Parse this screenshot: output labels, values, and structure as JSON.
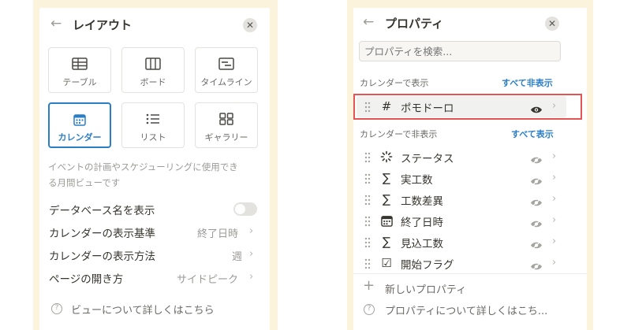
{
  "layout_panel": {
    "title": "レイアウト",
    "layouts": [
      {
        "label": "テーブル",
        "icon": "table-icon",
        "selected": false
      },
      {
        "label": "ボード",
        "icon": "board-icon",
        "selected": false
      },
      {
        "label": "タイムライン",
        "icon": "timeline-icon",
        "selected": false
      },
      {
        "label": "カレンダー",
        "icon": "calendar-icon",
        "selected": true
      },
      {
        "label": "リスト",
        "icon": "list-icon",
        "selected": false
      },
      {
        "label": "ギャラリー",
        "icon": "gallery-icon",
        "selected": false
      }
    ],
    "description_line1": "イベントの計画やスケジューリングに使用でき",
    "description_line2": "る月間ビューです",
    "settings": [
      {
        "label": "データベース名を表示",
        "value": "",
        "toggle": false
      },
      {
        "label": "カレンダーの表示基準",
        "value": "終了日時"
      },
      {
        "label": "カレンダーの表示方法",
        "value": "週"
      },
      {
        "label": "ページの開き方",
        "value": "サイドピーク"
      }
    ],
    "help": "ビューについて詳しくはこちら"
  },
  "properties_panel": {
    "title": "プロパティ",
    "search_placeholder": "プロパティを検索...",
    "shown_section": {
      "label": "カレンダーで表示",
      "action": "すべて非表示",
      "items": [
        {
          "name": "ポモドーロ",
          "icon": "number-icon",
          "glyph": "#",
          "visible": true
        }
      ]
    },
    "hidden_section": {
      "label": "カレンダーで非表示",
      "action": "すべて表示",
      "items": [
        {
          "name": "ステータス",
          "icon": "status-icon",
          "glyph": "",
          "visible": false
        },
        {
          "name": "実工数",
          "icon": "sigma-icon",
          "glyph": "∑",
          "visible": false
        },
        {
          "name": "工数差異",
          "icon": "sigma-icon",
          "glyph": "∑",
          "visible": false
        },
        {
          "name": "終了日時",
          "icon": "calendar-icon",
          "glyph": "",
          "visible": false
        },
        {
          "name": "見込工数",
          "icon": "sigma-icon",
          "glyph": "∑",
          "visible": false
        },
        {
          "name": "開始フラグ",
          "icon": "checkbox-icon",
          "glyph": "☑",
          "visible": false
        }
      ]
    },
    "new_property": "新しいプロパティ",
    "help": "プロパティについて詳しくはこち..."
  },
  "colors": {
    "frame": "#fbf3dc",
    "accent": "#2a7ec6",
    "highlight": "#e55353"
  }
}
